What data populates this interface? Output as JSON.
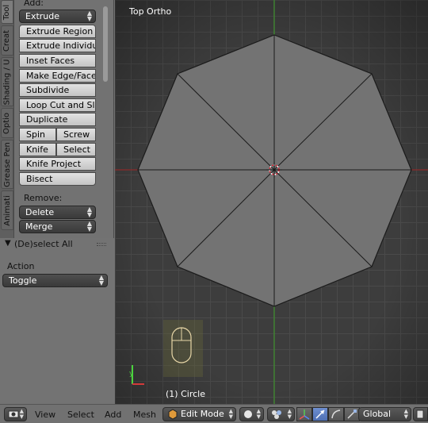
{
  "toolshelf": {
    "tabs": [
      "Tool",
      "Creat",
      "Shading / U",
      "Optio",
      "Grease Pen",
      "Animati"
    ],
    "add_label": "Add:",
    "extrude_dropdown": "Extrude",
    "buttons": {
      "extrude_region": "Extrude Region",
      "extrude_individual": "Extrude Individual",
      "inset_faces": "Inset Faces",
      "make_edge_face": "Make Edge/Face",
      "subdivide": "Subdivide",
      "loop_cut": "Loop Cut and Slide",
      "duplicate": "Duplicate",
      "spin": "Spin",
      "screw": "Screw",
      "knife": "Knife",
      "select": "Select",
      "knife_project": "Knife Project",
      "bisect": "Bisect"
    },
    "remove_label": "Remove:",
    "delete_dropdown": "Delete",
    "merge_dropdown": "Merge"
  },
  "operator_panel": {
    "title": "(De)select All",
    "action_label": "Action",
    "action_value": "Toggle"
  },
  "viewport": {
    "view_name": "Top Ortho",
    "object_status": "(1) Circle",
    "grid_color": "#4a4a4a",
    "background_color": "#3d3d3d",
    "face_color": "#737373",
    "x_axis_color": "#8b2a2a",
    "y_axis_color": "#3e8a2e"
  },
  "header": {
    "menus": [
      "View",
      "Select",
      "Add",
      "Mesh"
    ],
    "mode": "Edit Mode",
    "orientation": "Global"
  }
}
